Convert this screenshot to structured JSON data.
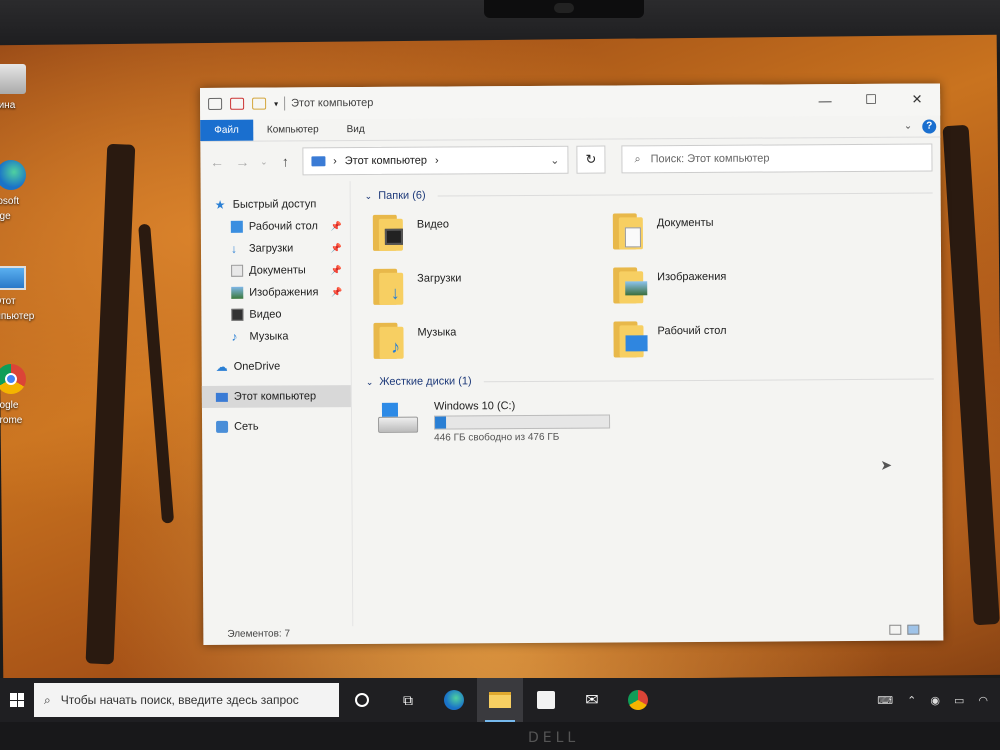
{
  "desktop": {
    "icons": [
      {
        "label": "зина",
        "icon": "recycle-bin-icon"
      },
      {
        "label": "rosoft\ndge",
        "icon": "edge-icon"
      },
      {
        "label": "Этот\nмпьютер",
        "icon": "computer-icon"
      },
      {
        "label": "oogle\nhrome",
        "icon": "chrome-icon"
      }
    ]
  },
  "window": {
    "title": "Этот компьютер",
    "controls": {
      "minimize": "—",
      "maximize": "☐",
      "close": "✕"
    },
    "ribbon_tabs": [
      "Файл",
      "Компьютер",
      "Вид"
    ],
    "help": "?",
    "address": {
      "path": "Этот компьютер",
      "separator": "›"
    },
    "search": {
      "placeholder": "Поиск: Этот компьютер"
    }
  },
  "sidebar": {
    "quick_access": "Быстрый доступ",
    "items": [
      {
        "label": "Рабочий стол",
        "icon": "desktop-folder-icon",
        "pinned": true
      },
      {
        "label": "Загрузки",
        "icon": "downloads-icon",
        "pinned": true
      },
      {
        "label": "Документы",
        "icon": "documents-icon",
        "pinned": true
      },
      {
        "label": "Изображения",
        "icon": "pictures-icon",
        "pinned": true
      },
      {
        "label": "Видео",
        "icon": "videos-icon",
        "pinned": false
      },
      {
        "label": "Музыка",
        "icon": "music-icon",
        "pinned": false
      }
    ],
    "onedrive": "OneDrive",
    "this_pc": "Этот компьютер",
    "network": "Сеть"
  },
  "folders_group": {
    "title": "Папки (6)",
    "folders": [
      {
        "name": "Видео",
        "icon": "videos-folder-icon"
      },
      {
        "name": "Документы",
        "icon": "documents-folder-icon"
      },
      {
        "name": "Загрузки",
        "icon": "downloads-folder-icon"
      },
      {
        "name": "Изображения",
        "icon": "pictures-folder-icon"
      },
      {
        "name": "Музыка",
        "icon": "music-folder-icon"
      },
      {
        "name": "Рабочий стол",
        "icon": "desktop-folder-icon"
      }
    ]
  },
  "drives_group": {
    "title": "Жесткие диски (1)",
    "drives": [
      {
        "name": "Windows 10 (C:)",
        "free_text": "446 ГБ свободно из 476 ГБ",
        "used_fraction": 0.063
      }
    ]
  },
  "statusbar": {
    "items_count": "Элементов: 7"
  },
  "taskbar": {
    "search_placeholder": "Чтобы начать поиск, введите здесь запрос",
    "accent": "#76b9ed"
  },
  "colors": {
    "ribbon_file_tab": "#1a6fcf",
    "folder_yellow": "#f7cf62",
    "drive_bar": "#2a7fd4"
  }
}
